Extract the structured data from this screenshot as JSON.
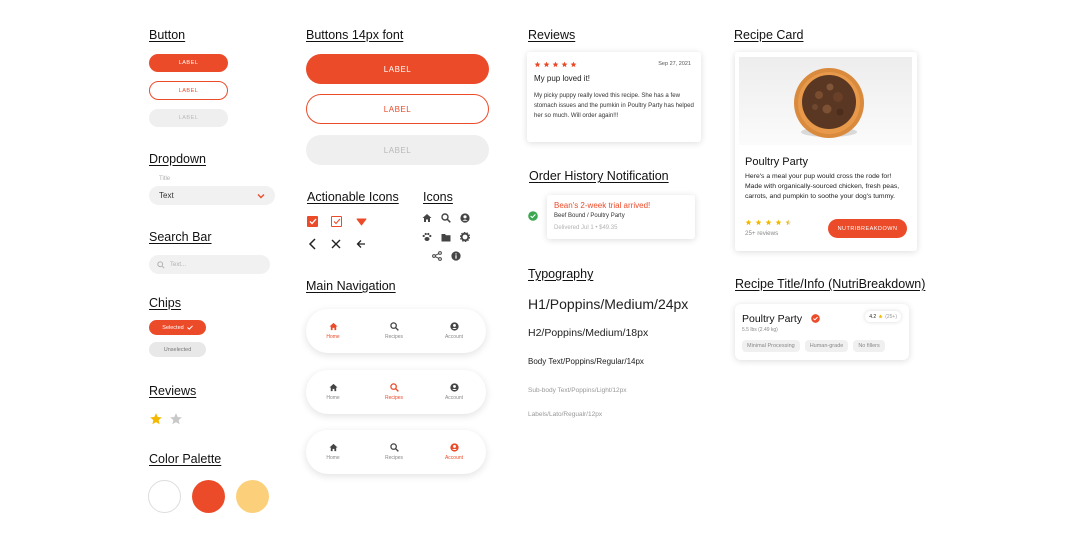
{
  "colors": {
    "accent": "#ec4b2a",
    "yellow": "#fcd07a",
    "success": "#3aa850"
  },
  "headings": {
    "button": "Button",
    "buttons14": "Buttons 14px font",
    "reviews_top": "Reviews",
    "recipe_card": "Recipe Card",
    "dropdown": "Dropdown",
    "actionable_icons": "Actionable Icons",
    "icons": "Icons",
    "order_history": "Order History Notification",
    "search_bar": "Search Bar",
    "main_navigation": "Main Navigation",
    "typography": "Typography",
    "recipe_title_info": "Recipe Title/Info (NutriBreakdown)",
    "chips": "Chips",
    "reviews_left": "Reviews",
    "color_palette": "Color Palette"
  },
  "buttons": {
    "label": "LABEL"
  },
  "dropdown": {
    "title": "Title",
    "value": "Text"
  },
  "search": {
    "placeholder": "Text..."
  },
  "chips": {
    "selected": "Selected",
    "unselected": "Unselected"
  },
  "rating_demo": {
    "filled": 1,
    "total": 2
  },
  "palette": [
    "#ffffff",
    "#ec4b2a",
    "#fcd07a"
  ],
  "navigation": {
    "items": [
      "Home",
      "Recipes",
      "Account"
    ],
    "active_per_bar": [
      "Home",
      "Recipes",
      "Account"
    ]
  },
  "review": {
    "stars": 5,
    "date": "Sep 27, 2021",
    "title": "My pup loved it!",
    "body": "My picky puppy really loved this recipe. She has a few stomach issues and the pumkin in Poultry Party has helped her so much. Will order again!!!"
  },
  "order_notification": {
    "title": "Bean's 2-week trial arrived!",
    "subtitle": "Beef Bound / Poultry Party",
    "meta": "Delivered Jul 1 • $49.35"
  },
  "typography": {
    "h1": "H1/Poppins/Medium/24px",
    "h2": "H2/Poppins/Medium/18px",
    "body": "Body Text/Poppins/Regular/14px",
    "subbody": "Sub-body Text/Poppins/Light/12px",
    "labels": "Labels/Lato/Regualr/12px"
  },
  "recipe_card": {
    "title": "Poultry Party",
    "description": "Here's a meal your pup would cross the rode for! Made with organically-sourced chicken, fresh peas, carrots, and pumpkin to soothe your dog's tummy.",
    "rating": 4.5,
    "reviews": "25+ reviews",
    "button": "NUTRIBREAKDOWN"
  },
  "recipe_info": {
    "title": "Poultry Party",
    "weight": "5.5 lbs (2.49 kg)",
    "rating": "4.2",
    "rating_count": "(25+)",
    "tags": [
      "Minimal Processing",
      "Human-grade",
      "No fillers"
    ]
  }
}
